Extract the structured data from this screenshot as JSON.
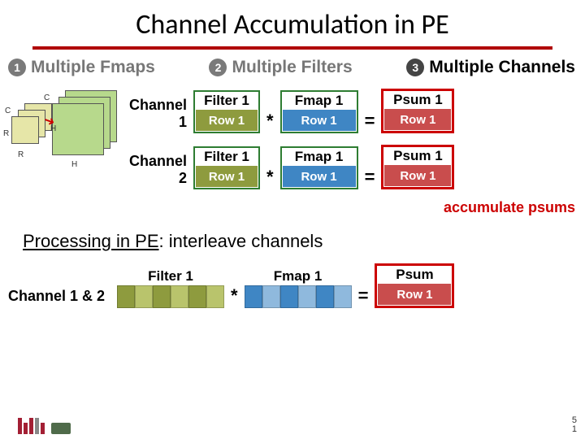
{
  "title": "Channel Accumulation in PE",
  "tabs": {
    "t1": {
      "num": "1",
      "label": "Multiple Fmaps"
    },
    "t2": {
      "num": "2",
      "label": "Multiple Filters"
    },
    "t3": {
      "num": "3",
      "label": "Multiple Channels"
    }
  },
  "dia": {
    "C": "C",
    "R": "R",
    "H": "H"
  },
  "ch1": {
    "label": "Channel 1",
    "filter_hdr": "Filter 1",
    "filter_val": "Row 1",
    "fmap_hdr": "Fmap 1",
    "fmap_val": "Row 1",
    "psum_hdr": "Psum 1",
    "psum_val": "Row 1",
    "op1": "*",
    "op2": "="
  },
  "ch2": {
    "label": "Channel 2",
    "filter_hdr": "Filter 1",
    "filter_val": "Row 1",
    "fmap_hdr": "Fmap 1",
    "fmap_val": "Row 1",
    "psum_hdr": "Psum 1",
    "psum_val": "Row 1",
    "op1": "*",
    "op2": "="
  },
  "accum_note": "accumulate psums",
  "proc": {
    "left": "Processing in PE",
    "right": ": interleave channels"
  },
  "bottom": {
    "label": "Channel 1 & 2",
    "filter_hdr": "Filter 1",
    "fmap_hdr": "Fmap 1",
    "psum_hdr": "Psum",
    "psum_val": "Row 1",
    "op1": "*",
    "op2": "="
  },
  "page": {
    "a": "5",
    "b": "1"
  }
}
